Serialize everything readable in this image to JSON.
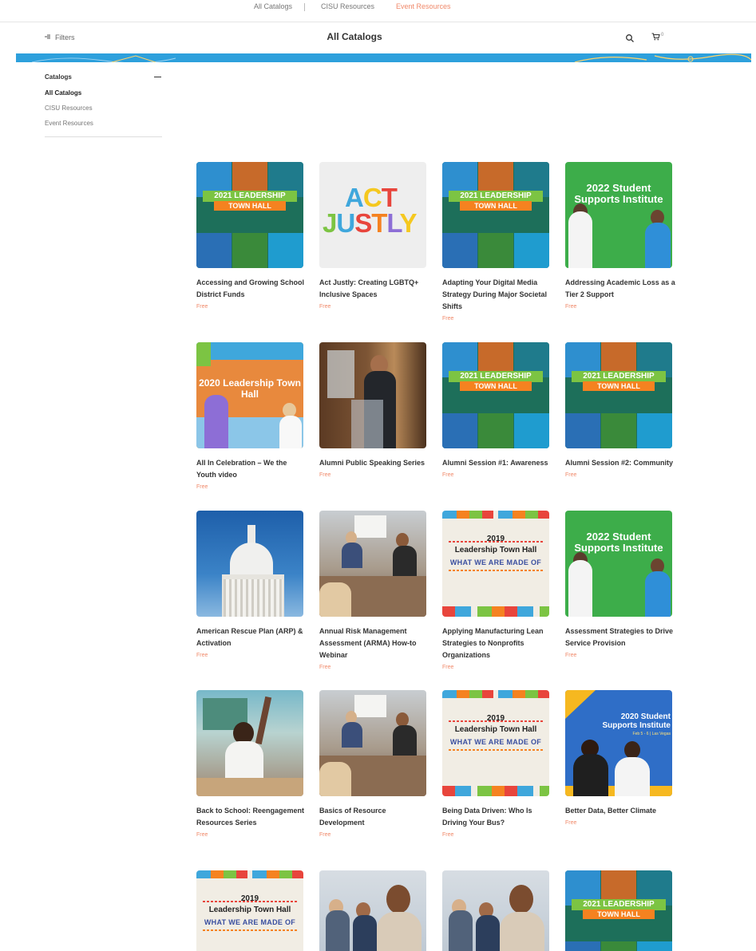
{
  "top_tabs": [
    "All Catalogs",
    "CISU Resources",
    "Event Resources"
  ],
  "header": {
    "filters_label": "Filters",
    "title": "All Catalogs",
    "cart_count": "0"
  },
  "sidebar": {
    "heading": "Catalogs",
    "items": [
      "All Catalogs",
      "CISU Resources",
      "Event Resources"
    ]
  },
  "thumbs": {
    "lth_line1": "2021 LEADERSHIP",
    "lth_line2": "TOWN HALL",
    "act_word1": "ACT",
    "act_word2": "JUSTLY",
    "ssi22_title": "2022 Student Supports Institute",
    "lt2020_title": "2020 Leadership Town Hall",
    "lt2019_year": "2019",
    "lt2019_line1": "Leadership Town Hall",
    "lt2019_line2": "WHAT WE ARE MADE OF",
    "ssi20_title": "2020 Student Supports Institute",
    "ssi20_date": "Feb 5 - 6 | Las Vegas"
  },
  "products": [
    {
      "name": "Accessing and Growing School District Funds",
      "price": "Free"
    },
    {
      "name": "Act Justly: Creating LGBTQ+ Inclusive Spaces",
      "price": "Free"
    },
    {
      "name": "Adapting Your Digital Media Strategy During Major Societal Shifts",
      "price": "Free"
    },
    {
      "name": "Addressing Academic Loss as a Tier 2 Support",
      "price": "Free"
    },
    {
      "name": "All In Celebration – We the Youth video",
      "price": "Free"
    },
    {
      "name": "Alumni Public Speaking Series",
      "price": "Free"
    },
    {
      "name": "Alumni Session #1: Awareness",
      "price": "Free"
    },
    {
      "name": "Alumni Session #2: Community",
      "price": "Free"
    },
    {
      "name": "American Rescue Plan (ARP) & Activation",
      "price": "Free"
    },
    {
      "name": "Annual Risk Management Assessment (ARMA) How-to Webinar",
      "price": "Free"
    },
    {
      "name": "Applying Manufacturing Lean Strategies to Nonprofits Organizations",
      "price": "Free"
    },
    {
      "name": "Assessment Strategies to Drive Service Provision",
      "price": "Free"
    },
    {
      "name": "Back to School: Reengagement Resources Series",
      "price": "Free"
    },
    {
      "name": "Basics of Resource Development",
      "price": "Free"
    },
    {
      "name": "Being Data Driven: Who Is Driving Your Bus?",
      "price": "Free"
    },
    {
      "name": "Better Data, Better Climate",
      "price": "Free"
    }
  ],
  "icons": {
    "filter": "filter-icon",
    "search": "search-icon",
    "cart": "cart-icon",
    "collapse": "minus-icon"
  },
  "colors": {
    "banner": "#2da0dc",
    "price": "#f0896a",
    "active_tab": "#f0896a"
  }
}
